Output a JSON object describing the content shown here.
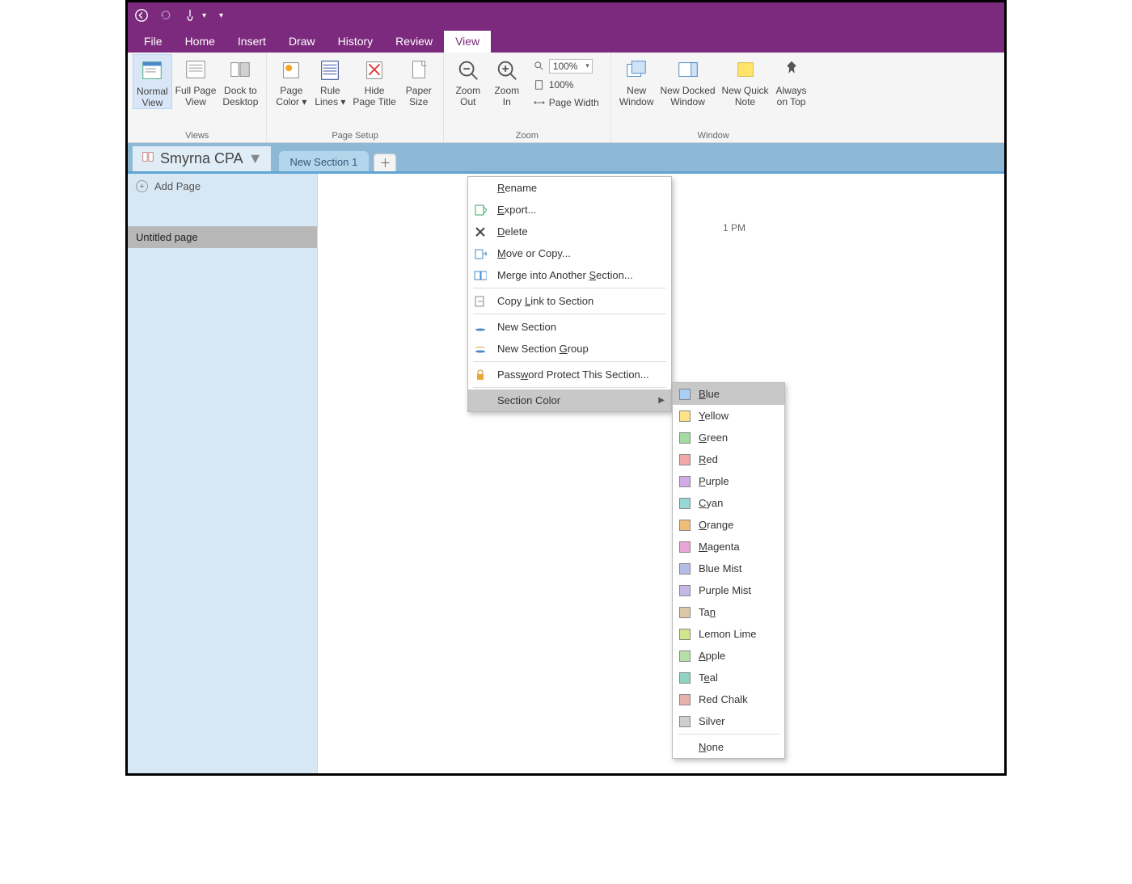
{
  "ribbon": {
    "tabs": [
      "File",
      "Home",
      "Insert",
      "Draw",
      "History",
      "Review",
      "View"
    ],
    "active_tab": "View",
    "groups": {
      "views": {
        "label": "Views",
        "buttons": [
          {
            "label": "Normal\nView",
            "active": true
          },
          {
            "label": "Full Page\nView"
          },
          {
            "label": "Dock to\nDesktop"
          }
        ]
      },
      "page_setup": {
        "label": "Page Setup",
        "buttons": [
          {
            "label": "Page\nColor ▾"
          },
          {
            "label": "Rule\nLines ▾"
          },
          {
            "label": "Hide\nPage Title"
          },
          {
            "label": "Paper\nSize"
          }
        ]
      },
      "zoom": {
        "label": "Zoom",
        "buttons": [
          {
            "label": "Zoom\nOut"
          },
          {
            "label": "Zoom\nIn"
          }
        ],
        "zoom_value": "100%",
        "hundred_label": "100%",
        "page_width_label": "Page Width"
      },
      "window": {
        "label": "Window",
        "buttons": [
          {
            "label": "New\nWindow"
          },
          {
            "label": "New Docked\nWindow"
          },
          {
            "label": "New Quick\nNote"
          },
          {
            "label": "Always\non Top"
          }
        ]
      }
    }
  },
  "notebook": {
    "name": "Smyrna CPA",
    "section_tab": "New Section 1"
  },
  "sidebar": {
    "add_page_label": "Add Page",
    "pages": [
      "Untitled page"
    ]
  },
  "canvas": {
    "timestamp_suffix": "1 PM"
  },
  "context_menu": {
    "items": [
      {
        "label_html": "<u class='ak'>R</u>ename",
        "icon": "rename"
      },
      {
        "label_html": "<u class='ak'>E</u>xport...",
        "icon": "export"
      },
      {
        "label_html": "<u class='ak'>D</u>elete",
        "icon": "delete"
      },
      {
        "label_html": "<u class='ak'>M</u>ove or Copy...",
        "icon": "move"
      },
      {
        "label_html": "Merge into Another <u class='ak'>S</u>ection...",
        "icon": "merge"
      },
      {
        "sep": true
      },
      {
        "label_html": "Copy <u class='ak'>L</u>ink to Section",
        "icon": "link"
      },
      {
        "sep": true
      },
      {
        "label_html": "New Section",
        "icon": "new-section"
      },
      {
        "label_html": "New Section <u class='ak'>G</u>roup",
        "icon": "new-group"
      },
      {
        "sep": true
      },
      {
        "label_html": "Pass<u class='ak'>w</u>ord Protect This Section...",
        "icon": "lock"
      },
      {
        "sep": true
      },
      {
        "label_html": "Section Color",
        "icon": "",
        "submenu": true,
        "hover": true
      }
    ]
  },
  "color_submenu": {
    "items": [
      {
        "label_html": "<u class='ak'>B</u>lue",
        "color": "#a9cef1",
        "hover": true
      },
      {
        "label_html": "<u class='ak'>Y</u>ellow",
        "color": "#ffe487"
      },
      {
        "label_html": "<u class='ak'>G</u>reen",
        "color": "#a3dca3"
      },
      {
        "label_html": "<u class='ak'>R</u>ed",
        "color": "#f2a7a7"
      },
      {
        "label_html": "<u class='ak'>P</u>urple",
        "color": "#d2abe6"
      },
      {
        "label_html": "<u class='ak'>C</u>yan",
        "color": "#96d8d8"
      },
      {
        "label_html": "<u class='ak'>O</u>range",
        "color": "#f2bc79"
      },
      {
        "label_html": "<u class='ak'>M</u>agenta",
        "color": "#e9a4d8"
      },
      {
        "label_html": "Blue Mist",
        "color": "#b4bde6"
      },
      {
        "label_html": "Purple Mist",
        "color": "#c5b7e6"
      },
      {
        "label_html": "Ta<u class='ak'>n</u>",
        "color": "#dcc8a6"
      },
      {
        "label_html": "Lemon Lime",
        "color": "#d1e58a"
      },
      {
        "label_html": "<u class='ak'>A</u>pple",
        "color": "#b6e0a8"
      },
      {
        "label_html": "T<u class='ak'>e</u>al",
        "color": "#8fd4c2"
      },
      {
        "label_html": "Red Chalk",
        "color": "#e7b1ac"
      },
      {
        "label_html": "Silver",
        "color": "#cfcfcf"
      },
      {
        "sep": true
      },
      {
        "label_html": "<u class='ak'>N</u>one",
        "none": true
      }
    ]
  }
}
